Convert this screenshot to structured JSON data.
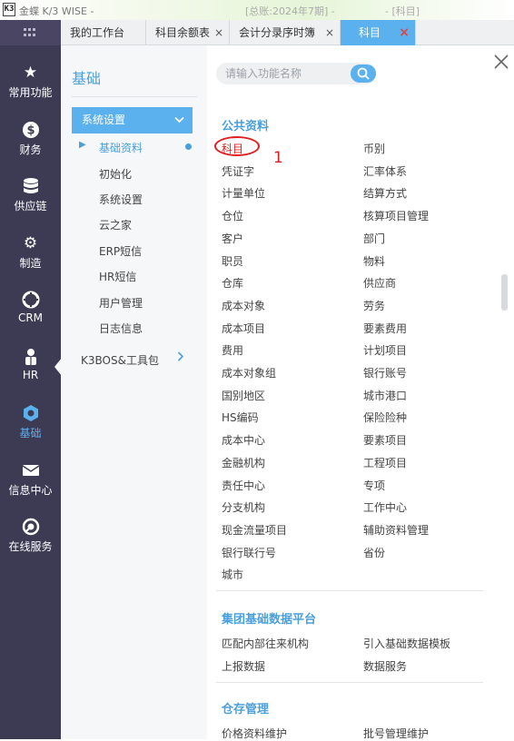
{
  "titlebar": {
    "logo": "K3",
    "app_title": "金蝶 K/3 WISE -",
    "account": "[总账:2024年7期] -",
    "module": "- [科目]"
  },
  "tabs": [
    {
      "label": "我的工作台"
    },
    {
      "label": "科目余额表",
      "close": "×"
    },
    {
      "label": "会计分录序时簿",
      "close": "×"
    },
    {
      "label": "科目",
      "close": "×",
      "active": true
    }
  ],
  "leftnav": [
    {
      "label": "常用功能",
      "icon": "star-icon"
    },
    {
      "label": "财务",
      "icon": "dollar-icon"
    },
    {
      "label": "供应链",
      "icon": "database-icon"
    },
    {
      "label": "制造",
      "icon": "gear-icon"
    },
    {
      "label": "CRM",
      "icon": "crm-icon"
    },
    {
      "label": "HR",
      "icon": "people-icon"
    },
    {
      "label": "基础",
      "icon": "base-icon",
      "active": true
    },
    {
      "label": "信息中心",
      "icon": "mail-icon"
    },
    {
      "label": "在线服务",
      "icon": "online-service-icon"
    }
  ],
  "subnav": {
    "title": "基础",
    "group": "系统设置",
    "items": [
      "基础资料",
      "初始化",
      "系统设置",
      "云之家",
      "ERP短信",
      "HR短信",
      "用户管理",
      "日志信息"
    ],
    "k3bos": "K3BOS&工具包"
  },
  "search": {
    "placeholder": "请输入功能名称"
  },
  "annotation": {
    "number": "1"
  },
  "sections": [
    {
      "title": "公共资料",
      "items": [
        [
          "科目",
          "币别"
        ],
        [
          "凭证字",
          "汇率体系"
        ],
        [
          "计量单位",
          "结算方式"
        ],
        [
          "仓位",
          "核算项目管理"
        ],
        [
          "客户",
          "部门"
        ],
        [
          "职员",
          "物料"
        ],
        [
          "仓库",
          "供应商"
        ],
        [
          "成本对象",
          "劳务"
        ],
        [
          "成本项目",
          "要素费用"
        ],
        [
          "费用",
          "计划项目"
        ],
        [
          "成本对象组",
          "银行账号"
        ],
        [
          "国别地区",
          "城市港口"
        ],
        [
          "HS编码",
          "保险险种"
        ],
        [
          "成本中心",
          "要素项目"
        ],
        [
          "金融机构",
          "工程项目"
        ],
        [
          "责任中心",
          "专项"
        ],
        [
          "分支机构",
          "工作中心"
        ],
        [
          "现金流量项目",
          "辅助资料管理"
        ],
        [
          "银行联行号",
          "省份"
        ],
        [
          "城市",
          ""
        ]
      ]
    },
    {
      "title": "集团基础数据平台",
      "items": [
        [
          "匹配内部往来机构",
          "引入基础数据模板"
        ],
        [
          "上报数据",
          "数据服务"
        ]
      ]
    },
    {
      "title": "仓存管理",
      "items": [
        [
          "价格资料维护",
          "批号管理维护"
        ]
      ]
    }
  ]
}
